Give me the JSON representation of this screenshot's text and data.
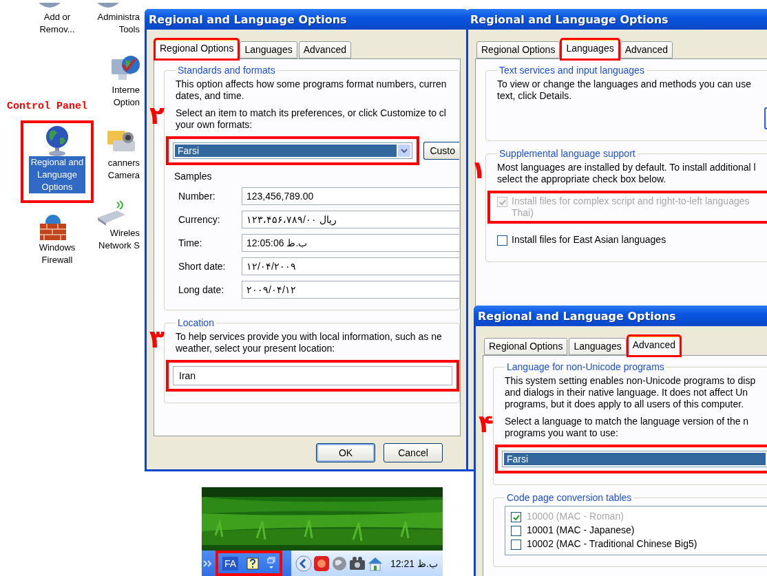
{
  "control_panel": {
    "heading": "Control Panel",
    "columns": [
      [
        {
          "kind": "cut",
          "label": "Add or\nRemov...",
          "selected": false,
          "highlighted": false
        },
        {
          "kind": "regional",
          "label": "Regional and\nLanguage\nOptions",
          "selected": true,
          "highlighted": true
        },
        {
          "kind": "firewall",
          "label": "Windows\nFirewall",
          "selected": false,
          "highlighted": false
        }
      ],
      [
        {
          "kind": "cut",
          "label": "Administra\nTools",
          "selected": false,
          "highlighted": false
        },
        {
          "kind": "internet",
          "label": "Interne\nOption",
          "selected": false,
          "highlighted": false
        },
        {
          "kind": "scanner",
          "label": "canners\nCamera",
          "selected": false,
          "highlighted": false
        },
        {
          "kind": "wireless",
          "label": "Wireles\nNetwork S",
          "selected": false,
          "highlighted": false
        }
      ]
    ]
  },
  "dialogs": [
    {
      "title": "Regional and Language Options",
      "tabs": [
        {
          "label": "Regional Options",
          "selected": true,
          "highlighted": true
        },
        {
          "label": "Languages",
          "selected": false,
          "highlighted": false
        },
        {
          "label": "Advanced",
          "selected": false,
          "highlighted": false
        }
      ],
      "groups": [
        {
          "title": "Standards and formats",
          "items": [
            {
              "kind": "paragraph",
              "text": "This option affects how some programs format numbers, curren\ndates, and time."
            },
            {
              "kind": "paragraph",
              "text": "Select an item to match its preferences, or click Customize to cl\nyour own formats:",
              "marker": "۲"
            },
            {
              "kind": "select",
              "value": "Farsi",
              "dropdown_arrow": true,
              "button": "Custo",
              "highlighted": true
            },
            {
              "kind": "samples",
              "title": "Samples",
              "rows": [
                {
                  "label": "Number:",
                  "value": "123,456,789.00"
                },
                {
                  "label": "Currency:",
                  "value": "۱۲۳،۴۵۶،۷۸۹/۰۰ ریال"
                },
                {
                  "label": "Time:",
                  "value": "12:05:06 ب.ظ"
                },
                {
                  "label": "Short date:",
                  "value": "۱۲/۰۴/۲۰۰۹"
                },
                {
                  "label": "Long date:",
                  "value": "۲۰۰۹/۰۴/۱۲"
                }
              ]
            }
          ]
        },
        {
          "title": "Location",
          "items": [
            {
              "kind": "paragraph",
              "text": "To help services provide you with local information, such as ne\nweather, select your present location:",
              "marker": "۳"
            },
            {
              "kind": "field",
              "value": "Iran",
              "highlighted": true
            }
          ]
        }
      ],
      "buttons": [
        "OK",
        "Cancel"
      ]
    },
    {
      "title": "Regional and Language Options",
      "tabs": [
        {
          "label": "Regional Options",
          "selected": false,
          "highlighted": false
        },
        {
          "label": "Languages",
          "selected": true,
          "highlighted": true
        },
        {
          "label": "Advanced",
          "selected": false,
          "highlighted": false
        }
      ],
      "groups": [
        {
          "title": "Text services and input languages",
          "items": [
            {
              "kind": "paragraph",
              "text": "To view or change the languages and methods you can use\ntext, click Details."
            },
            {
              "kind": "button_stub"
            }
          ]
        },
        {
          "title": "Supplemental language support",
          "items": [
            {
              "kind": "paragraph",
              "text": "Most languages are installed by default. To install additional l\nselect the appropriate check box below.",
              "marker": "۱"
            },
            {
              "kind": "checkbox",
              "label": "Install files for complex script and right-to-left languages\nThai)",
              "checked": true,
              "disabled": true,
              "highlighted": true
            },
            {
              "kind": "checkbox",
              "label": "Install files for East Asian languages",
              "checked": false,
              "disabled": false,
              "highlighted": false
            }
          ]
        }
      ]
    },
    {
      "title": "Regional and Language Options",
      "tabs": [
        {
          "label": "Regional Options",
          "selected": false,
          "highlighted": false
        },
        {
          "label": "Languages",
          "selected": false,
          "highlighted": false
        },
        {
          "label": "Advanced",
          "selected": true,
          "highlighted": true
        }
      ],
      "groups": [
        {
          "title": "Language for non-Unicode programs",
          "items": [
            {
              "kind": "paragraph",
              "text": "This system setting enables non-Unicode programs to disp\nand dialogs in their native language. It does not affect Un\nprograms, but it does apply to all users of this computer."
            },
            {
              "kind": "paragraph",
              "text": "Select a language to match the language version of the n\nprograms you want to use:",
              "marker": "۴"
            },
            {
              "kind": "select",
              "value": "Farsi",
              "highlighted": true
            }
          ]
        },
        {
          "title": "Code page conversion tables",
          "items": [
            {
              "kind": "checklist",
              "items": [
                {
                  "label": "10000 (MAC - Roman)",
                  "checked": true,
                  "disabled": true
                },
                {
                  "label": "10001 (MAC - Japanese)",
                  "checked": false,
                  "disabled": false
                },
                {
                  "label": "10002 (MAC - Traditional Chinese Big5)",
                  "checked": false,
                  "disabled": false
                }
              ]
            }
          ]
        }
      ]
    }
  ],
  "taskbar": {
    "language": "FA",
    "clock": "12:21 ب.ظ",
    "highlighted": true
  }
}
